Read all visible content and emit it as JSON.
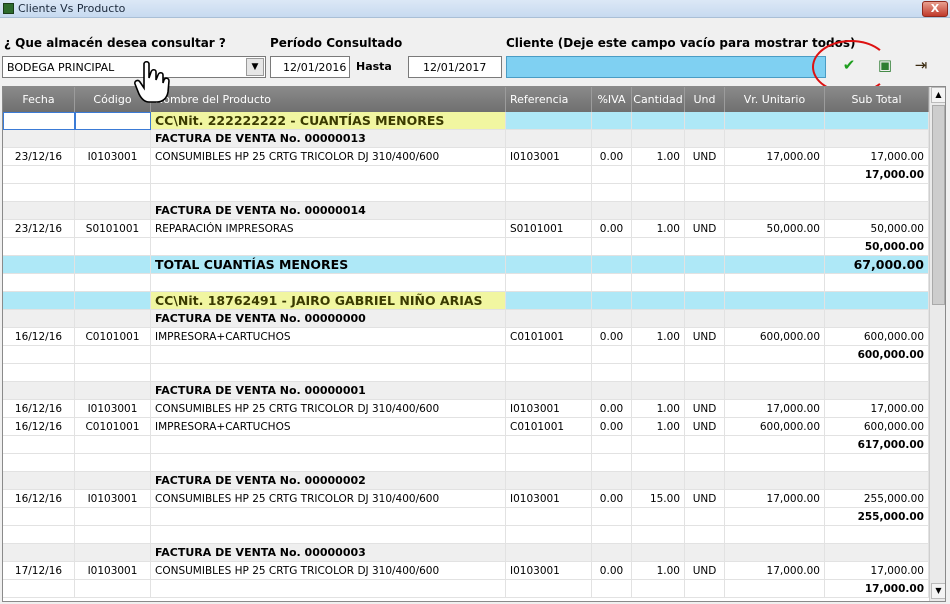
{
  "window": {
    "title": "Cliente Vs Producto",
    "close_label": "X"
  },
  "filters": {
    "almacen_label": "¿ Que almacén desea consultar ?",
    "almacen_value": "BODEGA PRINCIPAL",
    "periodo_label": "Período Consultado",
    "desde": "12/01/2016",
    "hasta_label": "Hasta",
    "hasta": "12/01/2017",
    "cliente_label": "Cliente (Deje este campo vacío para mostrar todos)",
    "cliente_value": ""
  },
  "toolbar": {
    "accept_icon": "check-icon",
    "export_icon": "export-icon",
    "exit_icon": "exit-icon"
  },
  "columns": [
    "Fecha",
    "Código",
    "Nombre del Producto",
    "Referencia",
    "%IVA",
    "Cantidad",
    "Und",
    "Vr. Unitario",
    "Sub Total"
  ],
  "rows": [
    {
      "type": "client",
      "nombre": "CC\\Nit. 222222222 - CUANTÍAS MENORES"
    },
    {
      "type": "fact",
      "nombre": "FACTURA DE VENTA No. 00000013"
    },
    {
      "type": "item",
      "fecha": "23/12/16",
      "codigo": "I0103001",
      "nombre": "CONSUMIBLES HP 25 CRTG TRICOLOR DJ 310/400/600",
      "referencia": "I0103001",
      "iva": "0.00",
      "cantidad": "1.00",
      "und": "UND",
      "unitario": "17,000.00",
      "subtotal": "17,000.00"
    },
    {
      "type": "sub",
      "subtotal": "17,000.00"
    },
    {
      "type": "blank"
    },
    {
      "type": "fact",
      "nombre": "FACTURA DE VENTA No. 00000014"
    },
    {
      "type": "item",
      "fecha": "23/12/16",
      "codigo": "S0101001",
      "nombre": "REPARACIÓN IMPRESORAS",
      "referencia": "S0101001",
      "iva": "0.00",
      "cantidad": "1.00",
      "und": "UND",
      "unitario": "50,000.00",
      "subtotal": "50,000.00"
    },
    {
      "type": "sub",
      "subtotal": "50,000.00"
    },
    {
      "type": "total",
      "nombre": "TOTAL CUANTÍAS MENORES",
      "subtotal": "67,000.00"
    },
    {
      "type": "blank"
    },
    {
      "type": "client",
      "nombre": "CC\\Nit. 18762491 - JAIRO GABRIEL NIÑO ARIAS"
    },
    {
      "type": "fact",
      "nombre": "FACTURA DE VENTA No. 00000000"
    },
    {
      "type": "item",
      "fecha": "16/12/16",
      "codigo": "C0101001",
      "nombre": "IMPRESORA+CARTUCHOS",
      "referencia": "C0101001",
      "iva": "0.00",
      "cantidad": "1.00",
      "und": "UND",
      "unitario": "600,000.00",
      "subtotal": "600,000.00"
    },
    {
      "type": "sub",
      "subtotal": "600,000.00"
    },
    {
      "type": "blank"
    },
    {
      "type": "fact",
      "nombre": "FACTURA DE VENTA No. 00000001"
    },
    {
      "type": "item",
      "fecha": "16/12/16",
      "codigo": "I0103001",
      "nombre": "CONSUMIBLES HP 25 CRTG TRICOLOR DJ 310/400/600",
      "referencia": "I0103001",
      "iva": "0.00",
      "cantidad": "1.00",
      "und": "UND",
      "unitario": "17,000.00",
      "subtotal": "17,000.00"
    },
    {
      "type": "item",
      "fecha": "16/12/16",
      "codigo": "C0101001",
      "nombre": "IMPRESORA+CARTUCHOS",
      "referencia": "C0101001",
      "iva": "0.00",
      "cantidad": "1.00",
      "und": "UND",
      "unitario": "600,000.00",
      "subtotal": "600,000.00"
    },
    {
      "type": "sub",
      "subtotal": "617,000.00"
    },
    {
      "type": "blank"
    },
    {
      "type": "fact",
      "nombre": "FACTURA DE VENTA No. 00000002"
    },
    {
      "type": "item",
      "fecha": "16/12/16",
      "codigo": "I0103001",
      "nombre": "CONSUMIBLES HP 25 CRTG TRICOLOR DJ 310/400/600",
      "referencia": "I0103001",
      "iva": "0.00",
      "cantidad": "15.00",
      "und": "UND",
      "unitario": "17,000.00",
      "subtotal": "255,000.00"
    },
    {
      "type": "sub",
      "subtotal": "255,000.00"
    },
    {
      "type": "blank"
    },
    {
      "type": "fact",
      "nombre": "FACTURA DE VENTA No. 00000003"
    },
    {
      "type": "item",
      "fecha": "17/12/16",
      "codigo": "I0103001",
      "nombre": "CONSUMIBLES HP 25 CRTG TRICOLOR DJ 310/400/600",
      "referencia": "I0103001",
      "iva": "0.00",
      "cantidad": "1.00",
      "und": "UND",
      "unitario": "17,000.00",
      "subtotal": "17,000.00"
    },
    {
      "type": "sub",
      "subtotal": "17,000.00"
    }
  ]
}
